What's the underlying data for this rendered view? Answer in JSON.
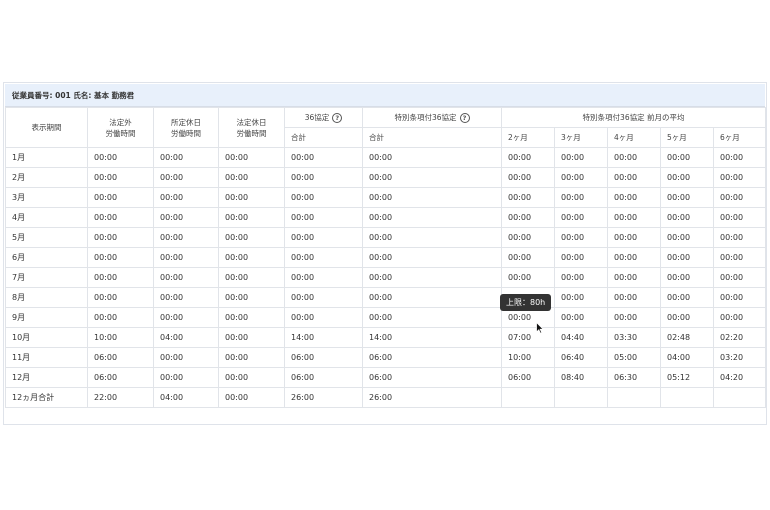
{
  "title": "従業員番号: 001 氏名: 基本 勤務君",
  "headers": {
    "period": "表示期間",
    "legal_overtime": [
      "法定外",
      "労働時間"
    ],
    "scheduled_holiday": [
      "所定休日",
      "労働時間"
    ],
    "legal_holiday": [
      "法定休日",
      "労働時間"
    ],
    "agreement36": "36協定",
    "special36": "特別条項付36協定",
    "special36_avg": "特別条項付36協定 前月の平均",
    "total": "合計",
    "months": [
      "2ヶ月",
      "3ヶ月",
      "4ヶ月",
      "5ヶ月",
      "6ヶ月"
    ]
  },
  "rows": [
    {
      "label": "1月",
      "values": [
        "00:00",
        "00:00",
        "00:00",
        "00:00",
        "00:00",
        "00:00",
        "00:00",
        "00:00",
        "00:00",
        "00:00"
      ]
    },
    {
      "label": "2月",
      "values": [
        "00:00",
        "00:00",
        "00:00",
        "00:00",
        "00:00",
        "00:00",
        "00:00",
        "00:00",
        "00:00",
        "00:00"
      ]
    },
    {
      "label": "3月",
      "values": [
        "00:00",
        "00:00",
        "00:00",
        "00:00",
        "00:00",
        "00:00",
        "00:00",
        "00:00",
        "00:00",
        "00:00"
      ]
    },
    {
      "label": "4月",
      "values": [
        "00:00",
        "00:00",
        "00:00",
        "00:00",
        "00:00",
        "00:00",
        "00:00",
        "00:00",
        "00:00",
        "00:00"
      ]
    },
    {
      "label": "5月",
      "values": [
        "00:00",
        "00:00",
        "00:00",
        "00:00",
        "00:00",
        "00:00",
        "00:00",
        "00:00",
        "00:00",
        "00:00"
      ]
    },
    {
      "label": "6月",
      "values": [
        "00:00",
        "00:00",
        "00:00",
        "00:00",
        "00:00",
        "00:00",
        "00:00",
        "00:00",
        "00:00",
        "00:00"
      ]
    },
    {
      "label": "7月",
      "values": [
        "00:00",
        "00:00",
        "00:00",
        "00:00",
        "00:00",
        "00:00",
        "00:00",
        "00:00",
        "00:00",
        "00:00"
      ]
    },
    {
      "label": "8月",
      "values": [
        "00:00",
        "00:00",
        "00:00",
        "00:00",
        "00:00",
        "",
        "00:00",
        "00:00",
        "00:00",
        "00:00"
      ]
    },
    {
      "label": "9月",
      "values": [
        "00:00",
        "00:00",
        "00:00",
        "00:00",
        "00:00",
        "00:00",
        "00:00",
        "00:00",
        "00:00",
        "00:00"
      ]
    },
    {
      "label": "10月",
      "values": [
        "10:00",
        "04:00",
        "00:00",
        "14:00",
        "14:00",
        "07:00",
        "04:40",
        "03:30",
        "02:48",
        "02:20"
      ]
    },
    {
      "label": "11月",
      "values": [
        "06:00",
        "00:00",
        "00:00",
        "06:00",
        "06:00",
        "10:00",
        "06:40",
        "05:00",
        "04:00",
        "03:20"
      ]
    },
    {
      "label": "12月",
      "values": [
        "06:00",
        "00:00",
        "00:00",
        "06:00",
        "06:00",
        "06:00",
        "08:40",
        "06:30",
        "05:12",
        "04:20"
      ]
    },
    {
      "label": "12ヵ月合計",
      "values": [
        "22:00",
        "04:00",
        "00:00",
        "26:00",
        "26:00",
        "",
        "",
        "",
        "",
        ""
      ]
    }
  ],
  "tooltip": "上限：80h",
  "colors": {
    "title_bg": "#e8f0fb",
    "border": "#e1e4e9",
    "tooltip_bg": "#333333"
  }
}
